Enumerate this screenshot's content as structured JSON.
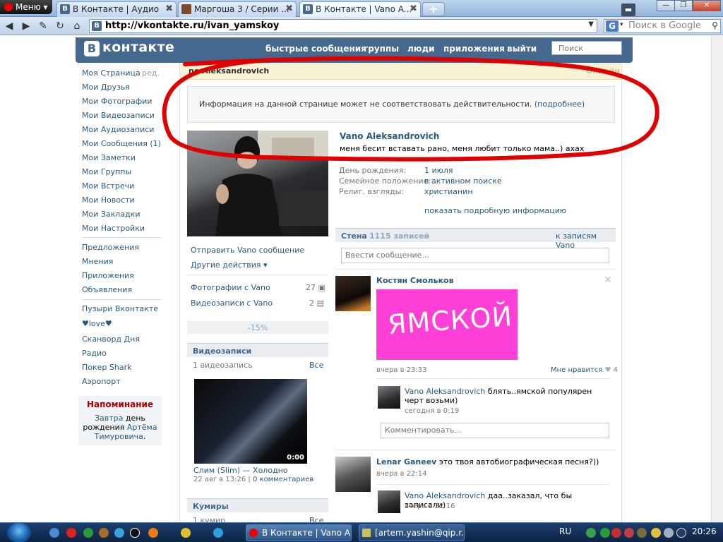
{
  "browser": {
    "menu_label": "Меню",
    "tabs": [
      {
        "title": "В Контакте | Аудио",
        "favicon": "vk-icon"
      },
      {
        "title": "Маргоша 3 / Серии ...",
        "favicon": "site-icon"
      },
      {
        "title": "В Контакте | Vano A...",
        "favicon": "vk-icon"
      }
    ],
    "url": "http://vkontakte.ru/ivan_yamskoy",
    "search_placeholder": "Поиск в Google"
  },
  "vk": {
    "logo": "контакте",
    "logo_letter": "В",
    "nav": [
      "быстрые сообщения",
      "группы",
      "люди",
      "приложения",
      "выйти"
    ],
    "search_placeholder": "Поиск",
    "leftnav": [
      "Моя Страница",
      "Мои Друзья",
      "Мои Фотографии",
      "Мои Видеозаписи",
      "Мои Аудиозаписи",
      "Мои Сообщения (1)",
      "Мои Заметки",
      "Мои Группы",
      "Мои Встречи",
      "Мои Новости",
      "Мои Закладки",
      "Мои Настройки"
    ],
    "leftnav_edit": "ред.",
    "leftnav2": [
      "Предложения",
      "Мнения",
      "Приложения",
      "Объявления"
    ],
    "leftnav3": [
      "Пузыри Вконтакте",
      "♥love♥",
      "Сканворд Дня",
      "Радио",
      "Покер Shark",
      "Аэропорт"
    ],
    "reminder": {
      "title": "Напоминание",
      "text_1": "Завтра",
      "text_2": "день рождения",
      "person": "Артёма Тимуровича",
      "dot": "."
    }
  },
  "profile": {
    "header_name": "no Aleksandrovich",
    "online": "Онлайн",
    "warning": "Информация на данной странице может не соответствовать действительности.",
    "warning_link": "(подробнее)",
    "name": "Vano Aleksandrovich",
    "status": "меня бесит вставать рано, меня любит только мама..) ахах",
    "info": [
      {
        "label": "День рождения:",
        "value": "1 июля"
      },
      {
        "label": "Семейное положение:",
        "value": "в активном поиске"
      },
      {
        "label": "Религ. взгляды:",
        "value": "христианин"
      }
    ],
    "show_more": "показать подробную информацию",
    "send_message": "Отправить Vano сообщение",
    "other_actions": "Другие действия",
    "photos_with": "Фотографии с Vano",
    "photos_count": "27",
    "videos_with": "Видеозаписи с Vano",
    "videos_count": "2",
    "percent": "-15%",
    "videos_section": {
      "title": "Видеозаписи",
      "count": "1 видеозапись",
      "all": "Все",
      "video_title": "Слим (Slim) — Холодно",
      "duration": "0:00",
      "date": "22 авг в 13:26",
      "comments": "0 комментариев"
    },
    "idols_section": {
      "title": "Кумиры",
      "count": "1 кумир",
      "all": "Все"
    }
  },
  "wall": {
    "title": "Стена",
    "count": "1115 записей",
    "to_wall": "к записям Vano",
    "input_placeholder": "Ввести сообщение...",
    "posts": [
      {
        "author": "Костян Смольков",
        "image_text": "ЯМСКОЙ",
        "date": "вчера в 23:33",
        "like_label": "Мне нравится",
        "likes": "4",
        "reply": {
          "author": "Vano Aleksandrovich",
          "text": "блять..ямской популярен черт возьми)",
          "date": "сегодня в 0:19"
        },
        "comment_placeholder": "Комментировать..."
      },
      {
        "author": "Lenar Ganeev",
        "text": "это твоя автобиографическая песня?))",
        "date": "вчера в 22:14",
        "reply": {
          "author": "Vano Aleksandrovich",
          "text": "даа..заказал, что бы записали)",
          "date": "вчера в 22:16"
        }
      }
    ]
  },
  "taskbar": {
    "buttons": [
      "В Контакте | Vano A...",
      "[artem.yashin@qip.r..."
    ],
    "lang": "RU",
    "time": "20:26"
  },
  "colors": {
    "vk_blue": "#45688e",
    "link": "#2b587a",
    "annotation_red": "#e00000",
    "pink": "#ff3fd6"
  }
}
